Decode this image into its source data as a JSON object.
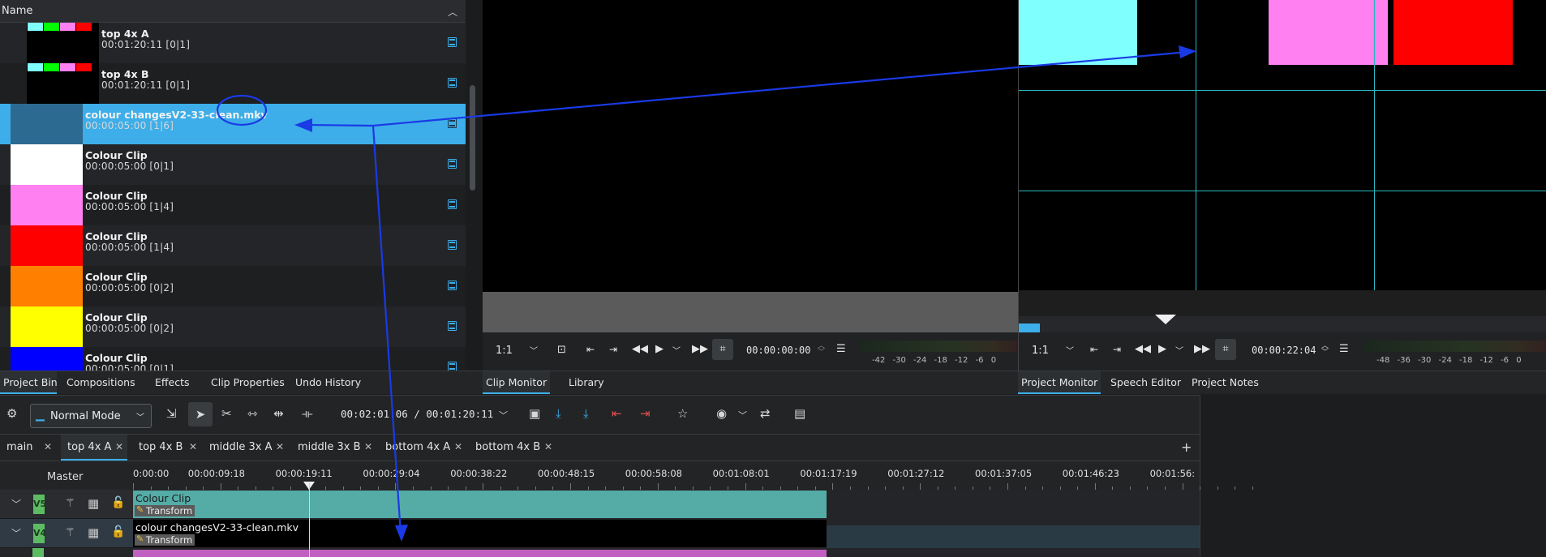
{
  "bin": {
    "header": "Name",
    "items": [
      {
        "title": "top 4x A",
        "sub": "00:01:20:11 [0|1]",
        "kind": "sequence"
      },
      {
        "title": "top 4x B",
        "sub": "00:01:20:11 [0|1]",
        "kind": "sequence"
      },
      {
        "title": "colour changesV2-33-clean.mkv",
        "sub": "00:00:05:00 [1|6]",
        "kind": "video",
        "color": "#2c6a91",
        "selected": true
      },
      {
        "title": "Colour Clip",
        "sub": "00:00:05:00 [0|1]",
        "color": "#ffffff"
      },
      {
        "title": "Colour Clip",
        "sub": "00:00:05:00 [1|4]",
        "color": "#ff80f0"
      },
      {
        "title": "Colour Clip",
        "sub": "00:00:05:00 [1|4]",
        "color": "#ff0000"
      },
      {
        "title": "Colour Clip",
        "sub": "00:00:05:00 [0|2]",
        "color": "#ff8000"
      },
      {
        "title": "Colour Clip",
        "sub": "00:00:05:00 [0|2]",
        "color": "#ffff00"
      },
      {
        "title": "Colour Clip",
        "sub": "00:00:05:00 [0|1]",
        "color": "#0000ff"
      }
    ],
    "seq_thumb_colors": [
      "#80ffff",
      "#00ff00",
      "#ff80f0",
      "#ff0000"
    ]
  },
  "left_tabs": [
    "Project Bin",
    "Compositions",
    "Effects",
    "Clip Properties",
    "Undo History"
  ],
  "clip_monitor": {
    "zoom": "1:1",
    "timecode": "00:00:00:00",
    "vu_scale": "-42 -30 -24 -18 -12 -6 0",
    "tabs": [
      "Clip Monitor",
      "Library"
    ]
  },
  "project_monitor": {
    "zoom": "1:1",
    "timecode": "00:00:22:04",
    "vu_scale": "-48 -36 -30 -24 -18 -12 -6 0",
    "tabs": [
      "Project Monitor",
      "Speech Editor",
      "Project Notes"
    ],
    "colors": {
      "cyan": "#80ffff",
      "pink": "#ff80f0",
      "red": "#ff0000",
      "guides": "#2ab8c0"
    }
  },
  "toolbar": {
    "mode": "Normal Mode",
    "time": "00:02:01:06 / 00:01:20:11"
  },
  "timeline": {
    "tabs": [
      "main",
      "top 4x A",
      "top 4x B",
      "middle 3x A",
      "middle 3x B",
      "bottom 4x A",
      "bottom 4x B"
    ],
    "active_tab": "top 4x A",
    "master_label": "Master",
    "ruler": [
      "0:00:00",
      "00:00:09:18",
      "00:00:19:11",
      "00:00:29:04",
      "00:00:38:22",
      "00:00:48:15",
      "00:00:58:08",
      "00:01:08:01",
      "00:01:17:19",
      "00:01:27:12",
      "00:01:37:05",
      "00:01:46:23",
      "00:01:56:"
    ],
    "tracks": [
      {
        "name": "V5",
        "clip": "Colour Clip",
        "effect": "Transform",
        "color": "#55aca6"
      },
      {
        "name": "V4",
        "clip": "colour changesV2-33-clean.mkv",
        "effect": "Transform",
        "color": "#000000"
      }
    ]
  },
  "annotation": {
    "arrow_color": "#1a3ae6"
  }
}
